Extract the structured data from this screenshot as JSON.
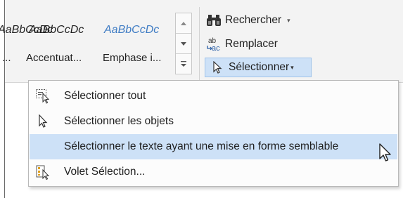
{
  "ribbon": {
    "styles": [
      {
        "sample": "AaBbCcDc",
        "name": "...",
        "color": "#1f1f1f"
      },
      {
        "sample": "AaBbCcDc",
        "name": "Accentuat...",
        "color": "#1f1f1f"
      },
      {
        "sample": "AaBbCcDc",
        "name": "Emphase i...",
        "color": "#3f7cc4"
      }
    ],
    "editing": {
      "find_label": "Rechercher",
      "replace_label": "Remplacer",
      "select_label": "Sélectionner",
      "select_caret": "▾",
      "find_caret": "▾"
    }
  },
  "menu": {
    "items": [
      {
        "label": "Sélectionner tout",
        "icon": "select-all-icon",
        "highlighted": false
      },
      {
        "label": "Sélectionner les objets",
        "icon": "pointer-arrow-icon",
        "highlighted": false
      },
      {
        "label": "Sélectionner le texte ayant une mise en forme semblable",
        "icon": "none",
        "highlighted": true
      },
      {
        "label": "Volet Sélection...",
        "icon": "selection-pane-icon",
        "highlighted": false
      }
    ]
  },
  "colors": {
    "highlight": "#cde1f7",
    "accent_style": "#3f7cc4"
  }
}
